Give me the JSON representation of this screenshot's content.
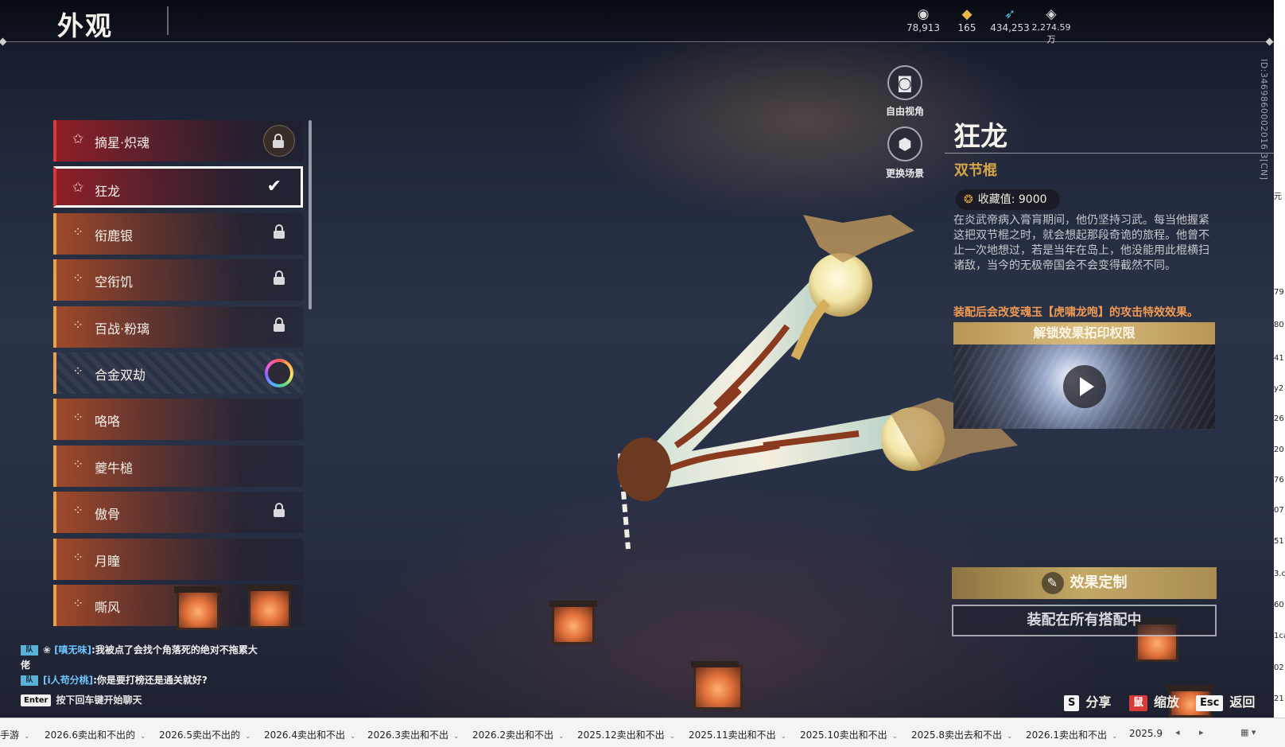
{
  "header": {
    "title": "外观",
    "currencies": [
      {
        "icon": "coin-icon",
        "value": "78,913"
      },
      {
        "icon": "ticket-icon",
        "value": "165"
      },
      {
        "icon": "feather-icon",
        "value": "434,253"
      },
      {
        "icon": "gem-icon",
        "value": "2,274.59万"
      }
    ]
  },
  "skins": [
    {
      "name": "摘星·炽魂",
      "state": "locked-circle",
      "rarity": "red"
    },
    {
      "name": "狂龙",
      "state": "selected",
      "rarity": "red"
    },
    {
      "name": "衔鹿银",
      "state": "locked",
      "rarity": "orange"
    },
    {
      "name": "空衔饥",
      "state": "locked",
      "rarity": "orange"
    },
    {
      "name": "百战·粉璃",
      "state": "locked",
      "rarity": "orange"
    },
    {
      "name": "合金双劫",
      "state": "ring",
      "rarity": "orange"
    },
    {
      "name": "咯咯",
      "state": "none",
      "rarity": "orange"
    },
    {
      "name": "夔牛槌",
      "state": "none",
      "rarity": "orange"
    },
    {
      "name": "傲骨",
      "state": "locked",
      "rarity": "orange"
    },
    {
      "name": "月瞳",
      "state": "none",
      "rarity": "orange"
    },
    {
      "name": "嘶风",
      "state": "none",
      "rarity": "orange"
    }
  ],
  "camera": {
    "free_view": "自由视角",
    "change_scene": "更换场景"
  },
  "item": {
    "name": "狂龙",
    "type": "双节棍",
    "collect_label": "收藏值: 9000",
    "description": "在炎武帝病入膏肓期间，他仍坚持习武。每当他握紧这把双节棍之时，就会想起那段奇诡的旅程。他曾不止一次地想过，若是当年在岛上，他没能用此棍横扫诸敌，当今的无极帝国会不会变得截然不同。",
    "effect_note": "装配后会改变魂玉【虎啸龙咆】的攻击特效效果。",
    "unlock_title": "解锁效果拓印权限",
    "custom_button": "效果定制",
    "equipped_button": "装配在所有搭配中",
    "uid": "ID:3469860002016 3[CN]"
  },
  "chat": {
    "messages": [
      {
        "speaker": "[嗔无味]",
        "text": ":我被点了会找个角落死的绝对不拖累大佬"
      },
      {
        "speaker": "[i人苟分桃]",
        "text": ":你是要打榜还是通关就好?"
      }
    ],
    "hint_key": "Enter",
    "hint": "按下回车键开始聊天"
  },
  "hints": [
    {
      "key": "S",
      "label": "分享"
    },
    {
      "key": "鼠",
      "label": "缩放"
    },
    {
      "key": "Esc",
      "label": "返回"
    }
  ],
  "taskbar": {
    "tabs": [
      "手游",
      "2026.6卖出和不出的",
      "2026.5卖出不出的",
      "2026.4卖出和不出",
      "2026.3卖出和不出",
      "2026.2卖出和不出",
      "2025.12卖出和不出",
      "2025.11卖出和不出",
      "2025.10卖出和不出",
      "2025.8卖出去和不出",
      "2026.1卖出和不出",
      "2025.9"
    ]
  },
  "right_strip": [
    "元",
    "79",
    "80",
    "41",
    "y2",
    "26",
    "20",
    "76",
    "07",
    "51",
    "3.c",
    "60",
    "1ca",
    "02",
    "21"
  ]
}
